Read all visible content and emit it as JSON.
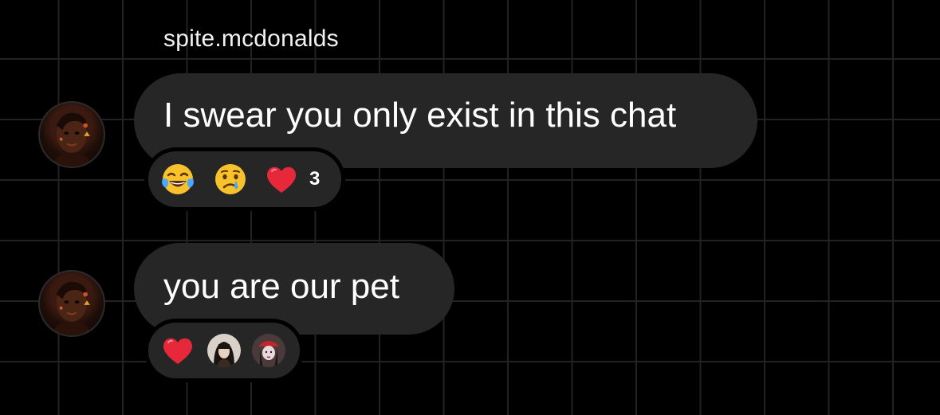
{
  "chat": {
    "sender_name": "spite.mcdonalds",
    "messages": [
      {
        "text": "I swear you only exist in this chat",
        "reactions": [
          {
            "icon": "face-with-tears-of-joy-icon"
          },
          {
            "icon": "crying-face-icon"
          },
          {
            "icon": "red-heart-icon"
          }
        ],
        "reaction_count": "3"
      },
      {
        "text": "you are our pet",
        "reactions": [
          {
            "icon": "red-heart-icon"
          },
          {
            "icon": "reactor-avatar-1"
          },
          {
            "icon": "reactor-avatar-2"
          }
        ]
      }
    ]
  },
  "colors": {
    "background": "#000000",
    "grid_line": "#222226",
    "bubble": "#262626",
    "text": "#ffffff",
    "heart": "#e6283a"
  }
}
